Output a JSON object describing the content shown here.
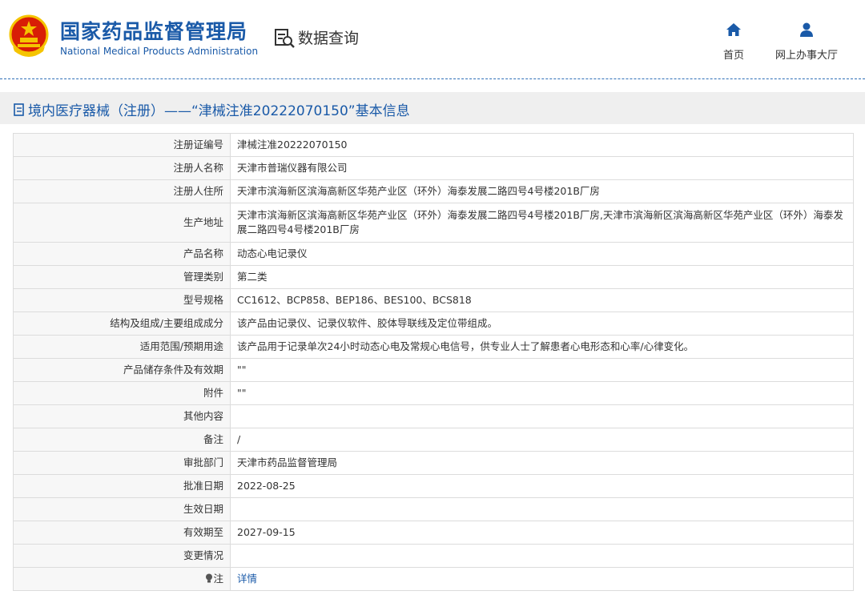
{
  "header": {
    "brand_cn": "国家药品监督管理局",
    "brand_en": "National Medical Products Administration",
    "search_label": "数据查询",
    "nav": [
      {
        "label": "首页",
        "icon": "home-icon"
      },
      {
        "label": "网上办事大厅",
        "icon": "user-icon"
      }
    ]
  },
  "page_title": "境内医疗器械（注册）——“津械注准20222070150”基本信息",
  "colors": {
    "brand_blue": "#1a5aa8",
    "emblem_red": "#d81e06",
    "emblem_gold": "#f5c400"
  },
  "rows": [
    {
      "label": "注册证编号",
      "value": "津械注准20222070150"
    },
    {
      "label": "注册人名称",
      "value": "天津市普瑞仪器有限公司"
    },
    {
      "label": "注册人住所",
      "value": "天津市滨海新区滨海高新区华苑产业区（环外）海泰发展二路四号4号楼201B厂房"
    },
    {
      "label": "生产地址",
      "value": "天津市滨海新区滨海高新区华苑产业区（环外）海泰发展二路四号4号楼201B厂房,天津市滨海新区滨海高新区华苑产业区（环外）海泰发展二路四号4号楼201B厂房"
    },
    {
      "label": "产品名称",
      "value": "动态心电记录仪"
    },
    {
      "label": "管理类别",
      "value": "第二类"
    },
    {
      "label": "型号规格",
      "value": "CC1612、BCP858、BEP186、BES100、BCS818"
    },
    {
      "label": "结构及组成/主要组成成分",
      "value": "该产品由记录仪、记录仪软件、胶体导联线及定位带组成。"
    },
    {
      "label": "适用范围/预期用途",
      "value": "该产品用于记录单次24小时动态心电及常规心电信号，供专业人士了解患者心电形态和心率/心律变化。"
    },
    {
      "label": "产品储存条件及有效期",
      "value": "\"\""
    },
    {
      "label": "附件",
      "value": "\"\""
    },
    {
      "label": "其他内容",
      "value": ""
    },
    {
      "label": "备注",
      "value": "/"
    },
    {
      "label": "审批部门",
      "value": "天津市药品监督管理局"
    },
    {
      "label": "批准日期",
      "value": "2022-08-25"
    },
    {
      "label": "生效日期",
      "value": ""
    },
    {
      "label": "有效期至",
      "value": "2027-09-15"
    },
    {
      "label": "变更情况",
      "value": ""
    },
    {
      "label": "注",
      "value": "详情",
      "icon": "lightbulb-icon"
    }
  ]
}
